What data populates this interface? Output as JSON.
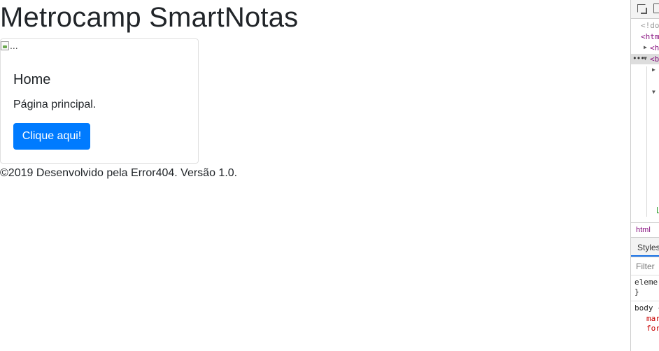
{
  "page": {
    "title": "Metrocamp SmartNotas",
    "card": {
      "image_alt": "...",
      "title": "Home",
      "text": "Página principal.",
      "button_label": "Clique aqui!"
    },
    "footer": "©2019 Desenvolvido pela Error404. Versão 1.0."
  },
  "devtools": {
    "source_lines": [
      "<!do",
      "<htm",
      "<he",
      "<b"
    ],
    "breadcrumb": "html",
    "styles_tab": "Styles",
    "filter_placeholder": "Filter",
    "rules": [
      "elemer",
      "}",
      "body {",
      "mar",
      "for"
    ]
  },
  "colors": {
    "primary_button": "#007bff",
    "text": "#212529"
  }
}
